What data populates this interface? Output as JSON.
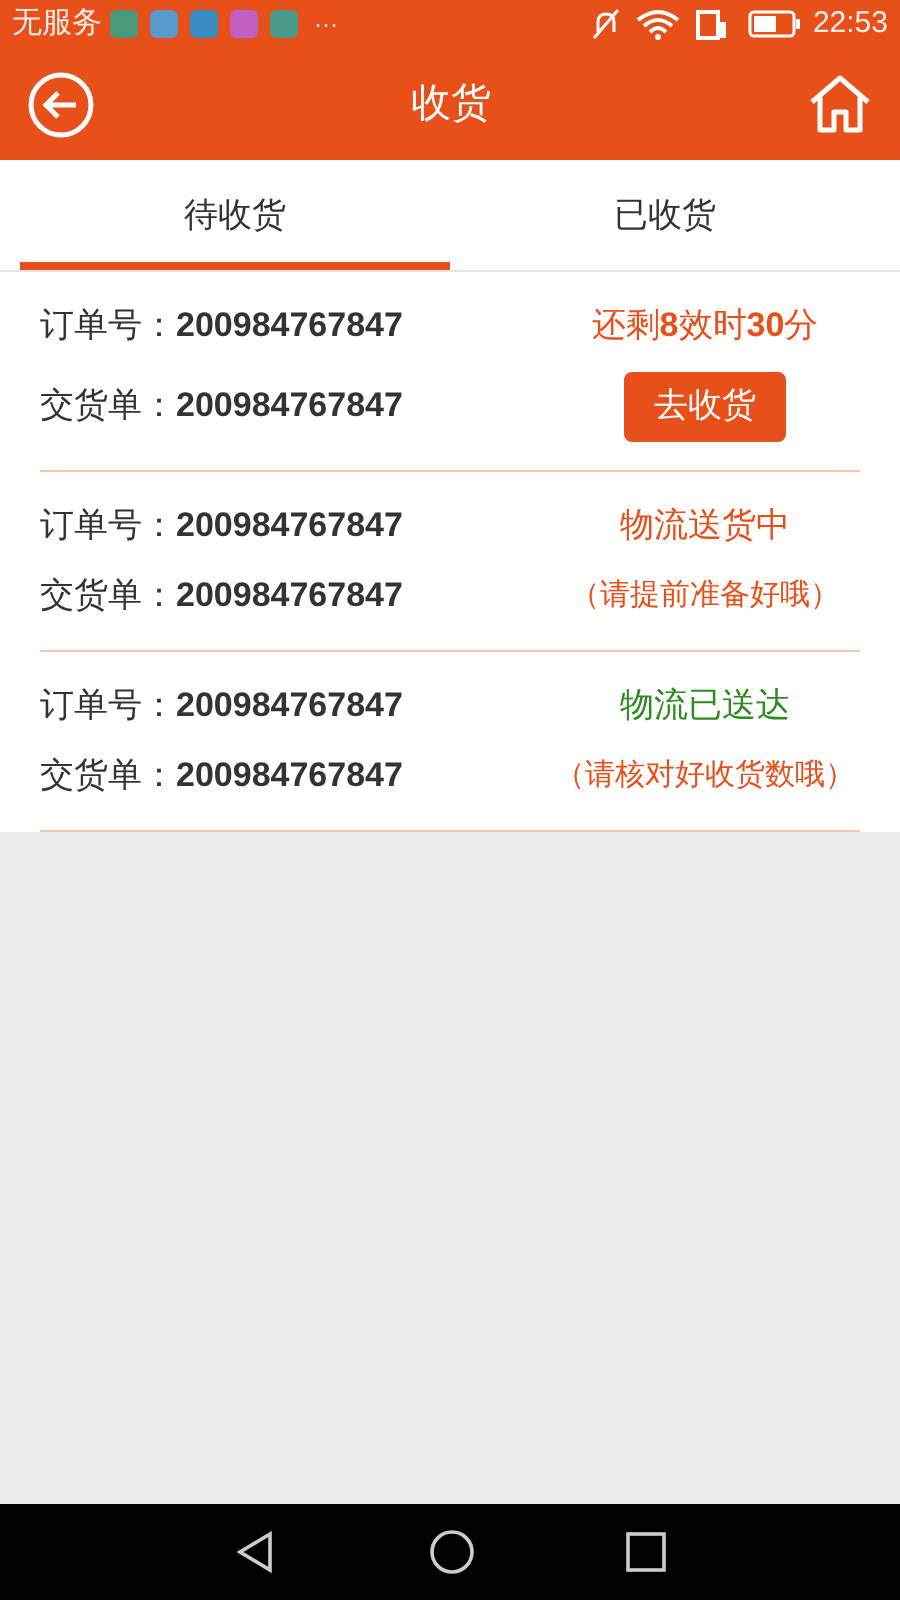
{
  "status_bar": {
    "carrier": "无服务",
    "more": "···",
    "time": "22:53"
  },
  "header": {
    "title": "收货"
  },
  "tabs": [
    {
      "label": "待收货",
      "selected": true
    },
    {
      "label": "已收货",
      "selected": false
    }
  ],
  "orders": [
    {
      "kind": "countdown",
      "order_label": "订单号：",
      "order_no": "200984767847",
      "delivery_label": "交货单：",
      "delivery_no": "200984767847",
      "status": "还剩**8**效时**30**分",
      "color": "#e8501a",
      "button": "去收货"
    },
    {
      "kind": "note",
      "order_label": "订单号：",
      "order_no": "200984767847",
      "delivery_label": "交货单：",
      "delivery_no": "200984767847",
      "status": "物流送货中",
      "color": "#e8501a",
      "note": "（请提前准备好哦）"
    },
    {
      "kind": "note",
      "order_label": "订单号：",
      "order_no": "200984767847",
      "delivery_label": "交货单：",
      "delivery_no": "200984767847",
      "status": "物流已送达",
      "color": "#2e8b1e",
      "note": "（请核对好收货数哦）"
    }
  ]
}
